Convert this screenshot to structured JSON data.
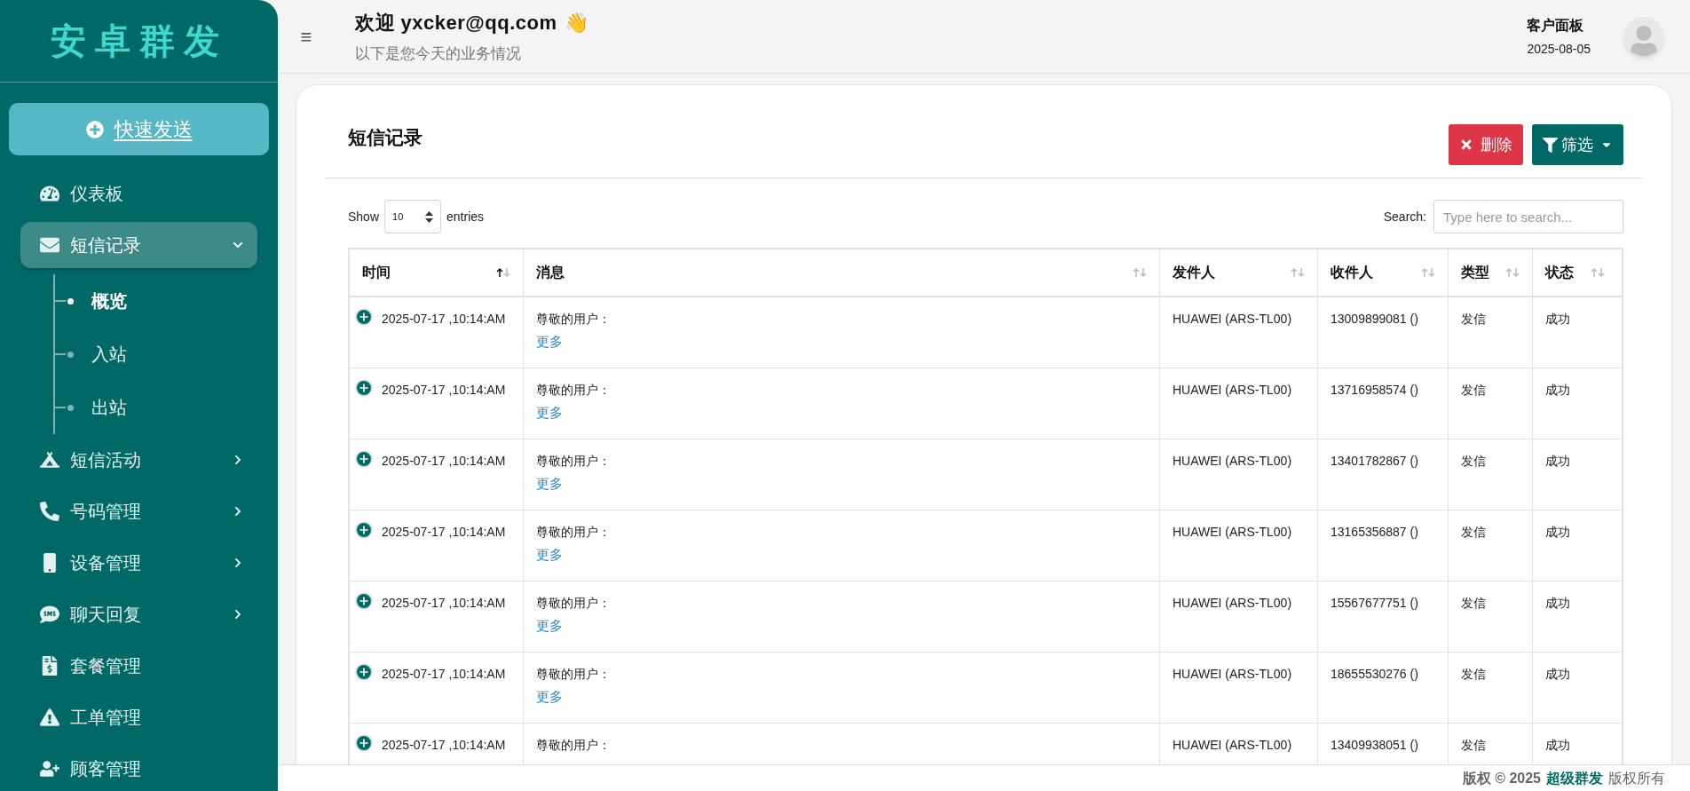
{
  "sidebar": {
    "logo": "安卓群发",
    "quick_send": "快速发送",
    "items": [
      {
        "label": "仪表板",
        "has_arrow": false,
        "selected": false
      },
      {
        "label": "短信记录",
        "expanded": true,
        "has_arrow": true,
        "selected": true,
        "children": [
          {
            "label": "概览",
            "selected": true
          },
          {
            "label": "入站",
            "selected": false
          },
          {
            "label": "出站",
            "selected": false
          }
        ]
      },
      {
        "label": "短信活动",
        "expanded": false,
        "has_arrow": true,
        "selected": false
      },
      {
        "label": "号码管理",
        "expanded": false,
        "has_arrow": true,
        "selected": false
      },
      {
        "label": "设备管理",
        "expanded": false,
        "has_arrow": true,
        "selected": false
      },
      {
        "label": "聊天回复",
        "expanded": false,
        "has_arrow": true,
        "selected": false
      },
      {
        "label": "套餐管理",
        "has_arrow": false,
        "selected": false
      },
      {
        "label": "工单管理",
        "has_arrow": false,
        "selected": false
      },
      {
        "label": "顾客管理",
        "has_arrow": false,
        "selected": false
      }
    ]
  },
  "header": {
    "menu_glyph": "≡",
    "greeting": "欢迎 yxcker@qq.com",
    "wave": "👋",
    "subtitle": "以下是您今天的业务情况",
    "panel_title": "客户面板",
    "date": "2025-08-05"
  },
  "card": {
    "title": "短信记录",
    "delete_button": "删除",
    "filter_button": "筛选",
    "show_label": "Show",
    "page_size": "10",
    "entries_label": "entries",
    "search_label": "Search:",
    "search": {
      "placeholder": "Type here to search..."
    },
    "table": {
      "columns": [
        {
          "label": "时间",
          "sorted": true
        },
        {
          "label": "消息",
          "sorted": false
        },
        {
          "label": "发件人",
          "sorted": false
        },
        {
          "label": "收件人",
          "sorted": false
        },
        {
          "label": "类型",
          "sorted": false
        },
        {
          "label": "状态",
          "sorted": false
        }
      ],
      "rows": [
        {
          "time": "2025-07-17 ,10:14:AM",
          "message": "尊敬的用户：",
          "more": "更多",
          "sender": "HUAWEI (ARS-TL00)",
          "recipient": "13009899081 ()",
          "type": "发信",
          "status": "成功"
        },
        {
          "time": "2025-07-17 ,10:14:AM",
          "message": "尊敬的用户：",
          "more": "更多",
          "sender": "HUAWEI (ARS-TL00)",
          "recipient": "13716958574 ()",
          "type": "发信",
          "status": "成功"
        },
        {
          "time": "2025-07-17 ,10:14:AM",
          "message": "尊敬的用户：",
          "more": "更多",
          "sender": "HUAWEI (ARS-TL00)",
          "recipient": "13401782867 ()",
          "type": "发信",
          "status": "成功"
        },
        {
          "time": "2025-07-17 ,10:14:AM",
          "message": "尊敬的用户：",
          "more": "更多",
          "sender": "HUAWEI (ARS-TL00)",
          "recipient": "13165356887 ()",
          "type": "发信",
          "status": "成功"
        },
        {
          "time": "2025-07-17 ,10:14:AM",
          "message": "尊敬的用户：",
          "more": "更多",
          "sender": "HUAWEI (ARS-TL00)",
          "recipient": "15567677751 ()",
          "type": "发信",
          "status": "成功"
        },
        {
          "time": "2025-07-17 ,10:14:AM",
          "message": "尊敬的用户：",
          "more": "更多",
          "sender": "HUAWEI (ARS-TL00)",
          "recipient": "18655530276 ()",
          "type": "发信",
          "status": "成功"
        },
        {
          "time": "2025-07-17 ,10:14:AM",
          "message": "尊敬的用户：",
          "sender": "HUAWEI (ARS-TL00)",
          "recipient": "13409938051 ()",
          "type": "发信",
          "status": "成功"
        }
      ]
    }
  },
  "footer": {
    "copyright": "版权 © 2025",
    "brand": "超级群发",
    "rights": "版权所有"
  }
}
